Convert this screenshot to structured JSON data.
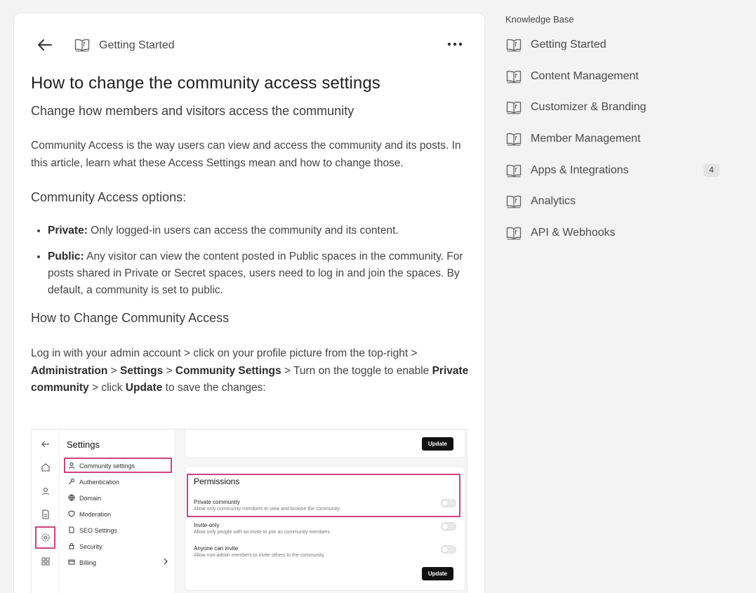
{
  "breadcrumb": "Getting Started",
  "article": {
    "title": "How to change the community access settings",
    "subtitle": "Change how members and visitors access the community",
    "intro": "Community Access is the way users can view and access the community and its posts. In this article, learn what these Access Settings mean and how to change those.",
    "options_heading": "Community Access options:",
    "private_label": "Private:",
    "private_text": " Only logged-in users can access the community and its content.",
    "public_label": "Public:",
    "public_text": " Any visitor can view the content posted in Public spaces in the community. For posts shared in Private or Secret spaces, users need to log in and join the spaces. By default, a community is set to public.",
    "change_heading": "How to Change Community Access",
    "steps": {
      "t1": "Log in with your admin account > click on your profile picture from the top-right > ",
      "b1": "Administration",
      "t2": " > ",
      "b2": "Settings",
      "t3": " > ",
      "b3": "Community Settings",
      "t4": " > Turn on the toggle to enable ",
      "b4": "Private community",
      "t5": " > click ",
      "b5": "Update",
      "t6": " to save the changes:"
    }
  },
  "screenshot": {
    "title": "Settings",
    "nav": [
      "Community settings",
      "Authentication",
      "Domain",
      "Moderation",
      "SEO Settings",
      "Security",
      "Billing"
    ],
    "update": "Update",
    "permissions": "Permissions",
    "options": [
      {
        "title": "Private community",
        "desc": "Allow only community members to view and browse the community."
      },
      {
        "title": "Invite-only",
        "desc": "Allow only people with an invite to join as community members."
      },
      {
        "title": "Anyone can invite",
        "desc": "Allow non-admin members to invite others to the community."
      }
    ],
    "highlight_color": "#d2407e"
  },
  "sidebar": {
    "title": "Knowledge Base",
    "items": [
      {
        "label": "Getting Started"
      },
      {
        "label": "Content Management"
      },
      {
        "label": "Customizer & Branding"
      },
      {
        "label": "Member Management"
      },
      {
        "label": "Apps & Integrations",
        "badge": "4"
      },
      {
        "label": "Analytics"
      },
      {
        "label": "API & Webhooks"
      }
    ]
  },
  "icons": [
    "back-arrow-icon",
    "book-icon",
    "more-icon"
  ]
}
